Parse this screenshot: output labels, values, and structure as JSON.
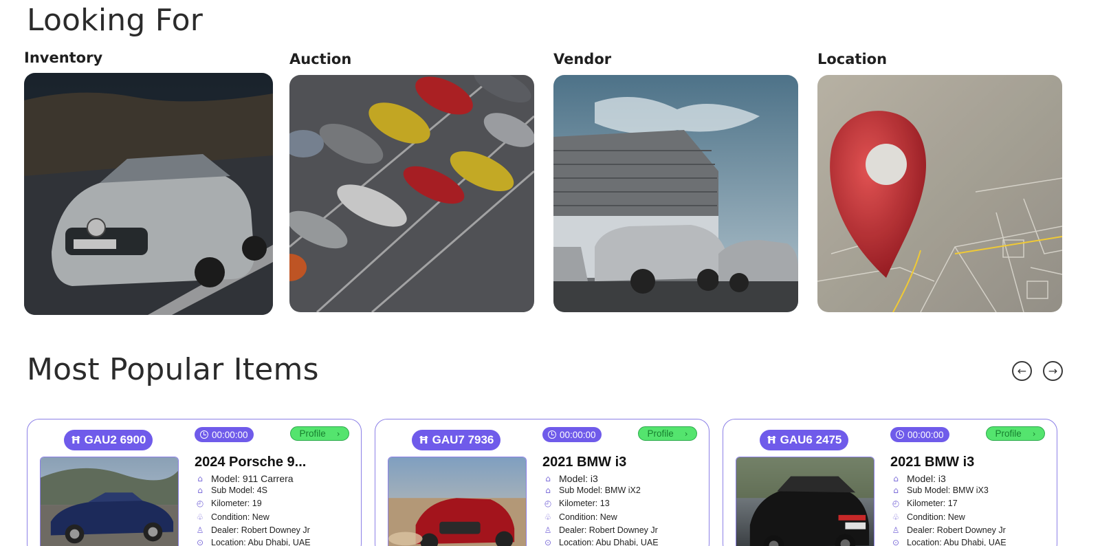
{
  "looking_for": {
    "title": "Looking For",
    "categories": [
      {
        "label": "Inventory"
      },
      {
        "label": "Auction"
      },
      {
        "label": "Vendor"
      },
      {
        "label": "Location"
      }
    ]
  },
  "popular": {
    "title": "Most Popular Items",
    "prev_icon": "arrow-left-circle-icon",
    "next_icon": "arrow-right-circle-icon",
    "items": [
      {
        "plate": "GAU2 6900",
        "timer": "00:00:00",
        "profile_label": "Profile",
        "title": "2024 Porsche 9...",
        "model": "Model: 911 Carrera",
        "sub_model": "Sub Model: 4S",
        "kilometer": "Kilometer: 19",
        "condition": "Condition: New",
        "dealer": "Dealer: Robert Downey Jr",
        "location": "Location: Abu Dhabi, UAE",
        "car_color": "#1c2a5a"
      },
      {
        "plate": "GAU7 7936",
        "timer": "00:00:00",
        "profile_label": "Profile",
        "title": "2021 BMW i3",
        "model": "Model: i3",
        "sub_model": "Sub Model: BMW iX2",
        "kilometer": "Kilometer: 13",
        "condition": "Condition: New",
        "dealer": "Dealer: Robert Downey Jr",
        "location": "Location: Abu Dhabi, UAE",
        "car_color": "#a3141c"
      },
      {
        "plate": "GAU6 2475",
        "timer": "00:00:00",
        "profile_label": "Profile",
        "title": "2021 BMW i3",
        "model": "Model: i3",
        "sub_model": "Sub Model: BMW iX3",
        "kilometer": "Kilometer: 17",
        "condition": "Condition: New",
        "dealer": "Dealer: Robert Downey Jr",
        "location": "Location: Abu Dhabi, UAE",
        "car_color": "#141414"
      }
    ]
  },
  "colors": {
    "accent": "#6f5bea",
    "profile_green": "#54e46e",
    "card_border": "#8b7fe6"
  }
}
